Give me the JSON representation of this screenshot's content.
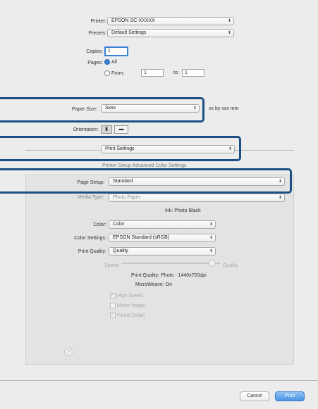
{
  "printer": {
    "label": "Printer:",
    "value": "EPSON SC-XXXXX"
  },
  "presets": {
    "label": "Presets:",
    "value": "Default Settings"
  },
  "copies": {
    "label": "Copies:",
    "value": "1"
  },
  "pages": {
    "label": "Pages:",
    "all": "All",
    "from": "From:",
    "from_value": "1",
    "to": "to:",
    "to_value": "1"
  },
  "paper_size": {
    "label": "Paper Size:",
    "value": "Sxxx",
    "note": "xx by xxx mm"
  },
  "orientation": {
    "label": "Orientation:"
  },
  "section_menu": {
    "value": "Print Settings"
  },
  "tab_header": {
    "value": "Printer Setup   Advanced Color Settings"
  },
  "page_setup": {
    "label": "Page Setup:",
    "value": "Standard"
  },
  "media_type": {
    "label": "Media Type:",
    "value": "Photo Paper"
  },
  "ink": {
    "value": "Ink:  Photo Black"
  },
  "color": {
    "label": "Color:",
    "value": "Color"
  },
  "color_settings": {
    "label": "Color Settings:",
    "value": "EPSON Standard (sRGB)"
  },
  "print_quality": {
    "label": "Print Quality:",
    "value": "Quality"
  },
  "slider": {
    "left": "Speed",
    "right": "Quality"
  },
  "quality_info": {
    "line1": "Print Quality:  Photo - 1440x720dpi",
    "line2": "MicroWeave:  On"
  },
  "options": {
    "high_speed": "High Speed",
    "mirror_image": "Mirror Image",
    "finest_detail": "Finest Detail"
  },
  "help": {
    "value": "?"
  },
  "buttons": {
    "cancel": "Cancel",
    "print": "Print"
  },
  "colors": {
    "highlight": "#1d4f86",
    "accent": "#3b82d6"
  }
}
